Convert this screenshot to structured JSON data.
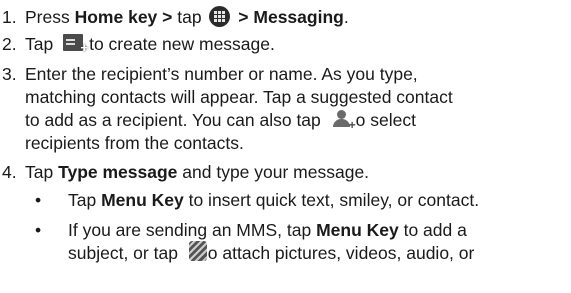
{
  "steps": [
    {
      "num": "1.",
      "pre": "Press ",
      "bold1": "Home key >",
      "mid": " tap ",
      "bold2": " > Messaging",
      "post": "."
    },
    {
      "num": "2.",
      "pre": "Tap ",
      "post": "to create new message."
    },
    {
      "num": "3.",
      "lines": [
        "Enter the recipient’s number or name. As you type,",
        "matching contacts will appear. Tap a suggested contact",
        "to add as a recipient. You can also tap "
      ],
      "line3_after": "o select",
      "line4": "recipients from the contacts."
    },
    {
      "num": "4.",
      "pre": "Tap ",
      "bold": "Type message",
      "post": " and type your message."
    }
  ],
  "bullets": [
    {
      "dot": "•",
      "pre": "Tap ",
      "bold": "Menu Key",
      "post": " to insert quick text, smiley, or contact."
    },
    {
      "dot": "•",
      "line1_pre": "If you are sending an MMS, tap ",
      "line1_bold": "Menu Key",
      "line1_post": " to add a",
      "line2_pre": "subject, or tap ",
      "line2_post": "o attach pictures, videos, audio, or"
    }
  ],
  "icons": {
    "apps": "apps-grid-icon",
    "compose": "new-message-icon",
    "contact": "add-contact-icon",
    "attach": "attach-icon"
  }
}
